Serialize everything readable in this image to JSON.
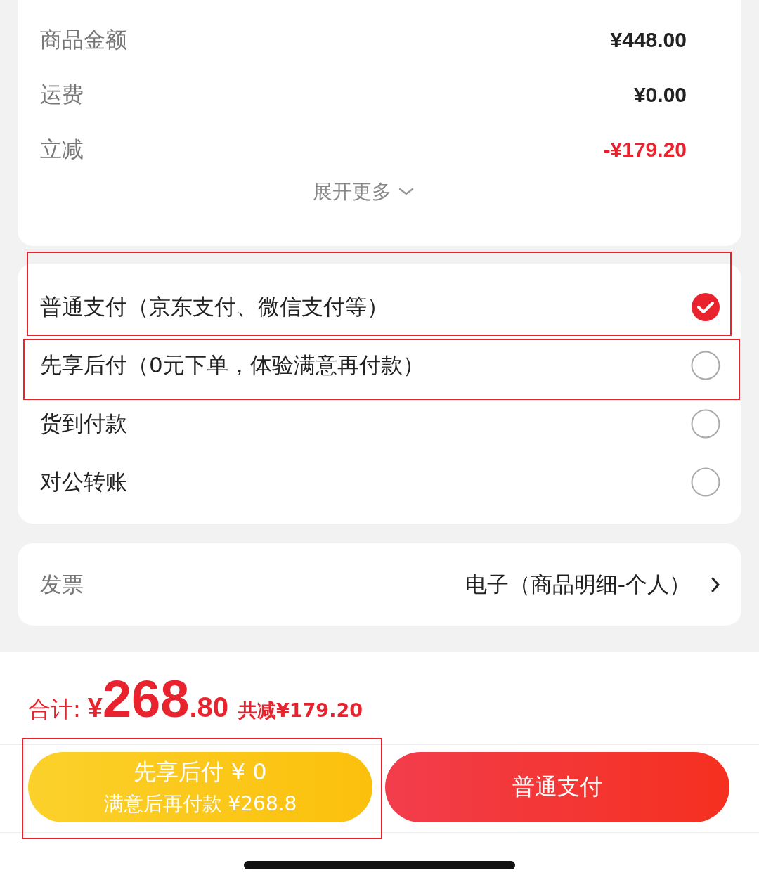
{
  "summary": {
    "rows": [
      {
        "label": "商品金额",
        "value": "¥448.00",
        "kind": "normal"
      },
      {
        "label": "运费",
        "value": "¥0.00",
        "kind": "normal"
      },
      {
        "label": "立减",
        "value": "-¥179.20",
        "kind": "discount"
      }
    ],
    "expand": {
      "label": "展开更多"
    }
  },
  "payment_options": [
    {
      "label": "普通支付（京东支付、微信支付等）",
      "selected": true,
      "highlighted": true
    },
    {
      "label": "先享后付（0元下单，体验满意再付款）",
      "selected": false,
      "highlighted": true
    },
    {
      "label": "货到付款",
      "selected": false,
      "highlighted": false
    },
    {
      "label": "对公转账",
      "selected": false,
      "highlighted": false
    }
  ],
  "invoice": {
    "label": "发票",
    "value": "电子（商品明细-个人）"
  },
  "total": {
    "label": "合计:",
    "currency": "¥",
    "integer": "268",
    "decimal": ".80",
    "saved": "共减¥179.20"
  },
  "buttons": [
    {
      "kind": "later",
      "line1": "先享后付 ¥ 0",
      "line2": "满意后再付款 ¥268.8",
      "highlighted": true
    },
    {
      "kind": "pay",
      "line1": "普通支付",
      "highlighted": false
    }
  ]
}
